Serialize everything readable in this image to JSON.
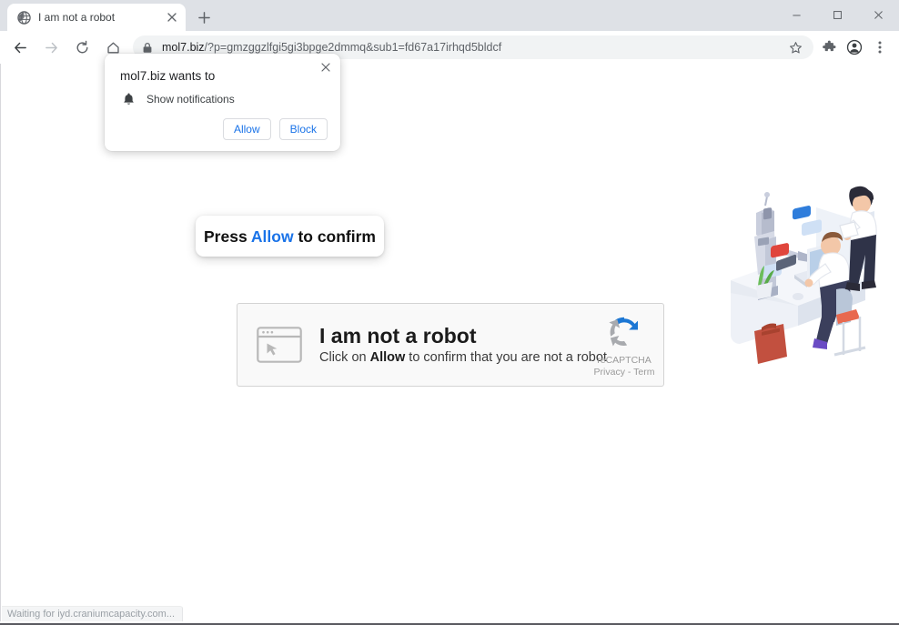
{
  "window": {
    "controls": {
      "minimize": "minimize-icon",
      "maximize": "maximize-icon",
      "close": "close-icon"
    }
  },
  "tabstrip": {
    "tab_title": "I am not a robot",
    "tab_favicon": "globe-icon",
    "tab_close": "×",
    "new_tab": "+"
  },
  "toolbar": {
    "back": "back-arrow-icon",
    "forward": "forward-arrow-icon",
    "reload": "reload-icon",
    "home": "home-icon",
    "lock": "lock-icon",
    "url_host": "mol7.biz",
    "url_path": "/?p=gmzggzlfgi5gi3bpge2dmmq&sub1=fd67a17irhqd5bldcf",
    "url_full": "mol7.biz/?p=gmzggzlfgi5gi3bpge2dmmq&sub1=fd67a17irhqd5bldcf",
    "star": "star-icon",
    "extensions": "puzzle-piece-icon",
    "profile": "profile-avatar-icon",
    "menu": "three-dot-menu-icon"
  },
  "permission_bubble": {
    "title": "mol7.biz wants to",
    "close_label": "×",
    "permission_icon": "bell-icon",
    "permission_label": "Show notifications",
    "allow_label": "Allow",
    "block_label": "Block",
    "accent_color": "#1a73e8"
  },
  "press_allow_tooltip": {
    "prefix": "Press ",
    "accent": "Allow",
    "suffix": " to confirm",
    "accent_color": "#1a73e8"
  },
  "captcha_card": {
    "icon": "browser-window-cursor-icon",
    "heading": "I am not a robot",
    "sub_prefix": "Click on ",
    "sub_bold": "Allow",
    "sub_suffix": " to confirm that you are not a robot",
    "brand_logo": "recaptcha-logo-icon",
    "brand_name": "reCAPTCHA",
    "brand_links": "Privacy - Term"
  },
  "illustration": {
    "name": "office-robot-workers-illustration"
  },
  "statusbar": {
    "text": "Waiting for iyd.craniumcapacity.com..."
  }
}
